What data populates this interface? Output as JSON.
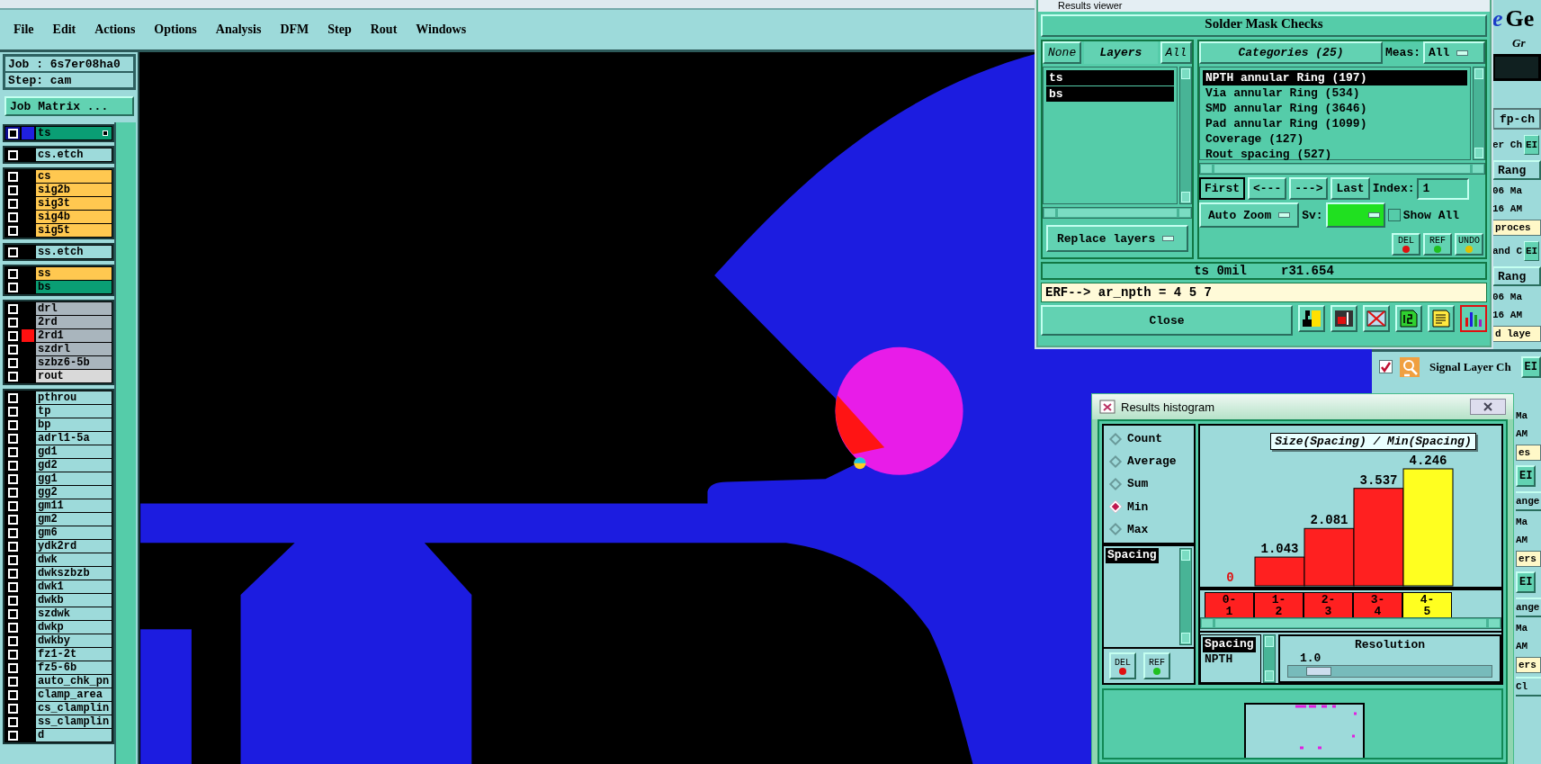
{
  "menu_bar": [
    "File",
    "Edit",
    "Actions",
    "Options",
    "Analysis",
    "DFM",
    "Step",
    "Rout",
    "Windows"
  ],
  "job_info": {
    "job": "Job : 6s7er08ha0",
    "step": "Step: cam",
    "matrix_button": "Job Matrix ..."
  },
  "layer_groups": [
    {
      "layers": [
        {
          "name": "ts",
          "kind": "mask",
          "color": "#2020e0",
          "active": true,
          "checked": false
        }
      ]
    },
    {
      "layers": [
        {
          "name": "cs.etch",
          "kind": "misc",
          "active": false,
          "checked": false
        }
      ]
    },
    {
      "layers": [
        {
          "name": "cs",
          "kind": "signal",
          "active": false,
          "checked": false
        },
        {
          "name": "sig2b",
          "kind": "signal",
          "active": false,
          "checked": false
        },
        {
          "name": "sig3t",
          "kind": "signal",
          "active": false,
          "checked": false
        },
        {
          "name": "sig4b",
          "kind": "signal",
          "active": false,
          "checked": false
        },
        {
          "name": "sig5t",
          "kind": "signal",
          "active": false,
          "checked": false
        }
      ]
    },
    {
      "layers": [
        {
          "name": "ss.etch",
          "kind": "misc",
          "active": false,
          "checked": false
        }
      ]
    },
    {
      "layers": [
        {
          "name": "ss",
          "kind": "signal",
          "active": false,
          "checked": false
        },
        {
          "name": "bs",
          "kind": "mask",
          "active": false,
          "checked": false
        }
      ]
    },
    {
      "layers": [
        {
          "name": "drl",
          "kind": "drill",
          "active": false,
          "checked": false
        },
        {
          "name": "2rd",
          "kind": "drill",
          "active": false,
          "checked": false
        },
        {
          "name": "2rd1",
          "kind": "drill",
          "color": "#ff1010",
          "active": false,
          "checked": false
        },
        {
          "name": "szdrl",
          "kind": "drill",
          "active": false,
          "checked": false
        },
        {
          "name": "szbz6-5b",
          "kind": "drill",
          "active": false,
          "checked": false
        },
        {
          "name": "rout",
          "kind": "rout",
          "active": false,
          "checked": false
        }
      ]
    },
    {
      "layers": [
        {
          "name": "pthrou",
          "kind": "misc",
          "active": false,
          "checked": false
        },
        {
          "name": "tp",
          "kind": "misc",
          "active": false,
          "checked": false
        },
        {
          "name": "bp",
          "kind": "misc",
          "active": false,
          "checked": false
        },
        {
          "name": "adrl1-5a",
          "kind": "misc",
          "active": false,
          "checked": false
        },
        {
          "name": "gd1",
          "kind": "misc",
          "active": false,
          "checked": false
        },
        {
          "name": "gd2",
          "kind": "misc",
          "active": false,
          "checked": false
        },
        {
          "name": "gg1",
          "kind": "misc",
          "active": false,
          "checked": false
        },
        {
          "name": "gg2",
          "kind": "misc",
          "active": false,
          "checked": false
        },
        {
          "name": "gm11",
          "kind": "misc",
          "active": false,
          "checked": false
        },
        {
          "name": "gm2",
          "kind": "misc",
          "active": false,
          "checked": false
        },
        {
          "name": "gm6",
          "kind": "misc",
          "active": false,
          "checked": false
        },
        {
          "name": "ydk2rd",
          "kind": "misc",
          "active": false,
          "checked": false
        },
        {
          "name": "dwk",
          "kind": "misc",
          "active": false,
          "checked": false
        },
        {
          "name": "dwkszbzb",
          "kind": "misc",
          "active": false,
          "checked": false
        },
        {
          "name": "dwk1",
          "kind": "misc",
          "active": false,
          "checked": false
        },
        {
          "name": "dwkb",
          "kind": "misc",
          "active": false,
          "checked": false
        },
        {
          "name": "szdwk",
          "kind": "misc",
          "active": false,
          "checked": false
        },
        {
          "name": "dwkp",
          "kind": "misc",
          "active": false,
          "checked": false
        },
        {
          "name": "dwkby",
          "kind": "misc",
          "active": false,
          "checked": false
        },
        {
          "name": "fz1-2t",
          "kind": "misc",
          "active": false,
          "checked": false
        },
        {
          "name": "fz5-6b",
          "kind": "misc",
          "active": false,
          "checked": false
        },
        {
          "name": "auto_chk_pn",
          "kind": "misc",
          "active": false,
          "checked": false
        },
        {
          "name": "clamp_area",
          "kind": "misc",
          "active": false,
          "checked": false
        },
        {
          "name": "cs_clamplin",
          "kind": "misc",
          "active": false,
          "checked": false
        },
        {
          "name": "ss_clamplin",
          "kind": "misc",
          "active": false,
          "checked": false
        },
        {
          "name": "d",
          "kind": "misc",
          "active": false,
          "checked": false
        }
      ]
    }
  ],
  "results_viewer": {
    "title": "Results viewer",
    "heading": "Solder Mask Checks",
    "layer_buttons": [
      "None",
      "Layers",
      "All"
    ],
    "layers": [
      {
        "name": "ts",
        "selected": true
      },
      {
        "name": "bs",
        "selected": true
      }
    ],
    "categories_button": "Categories (25)",
    "meas_label": "Meas:",
    "meas_value": "All",
    "categories": [
      {
        "label": "NPTH annular Ring (197)",
        "selected": true
      },
      {
        "label": "Via annular Ring (534)",
        "selected": false
      },
      {
        "label": "SMD annular Ring (3646)",
        "selected": false
      },
      {
        "label": "Pad annular Ring (1099)",
        "selected": false
      },
      {
        "label": "Coverage (127)",
        "selected": false
      },
      {
        "label": "Rout spacing (527)",
        "selected": false
      }
    ],
    "nav_buttons": [
      {
        "label": "First",
        "selected": true
      },
      {
        "label": "<---",
        "selected": false
      },
      {
        "label": "--->",
        "selected": false
      },
      {
        "label": "Last",
        "selected": false
      }
    ],
    "index_label": "Index:",
    "index_value": "1",
    "zoom_mode": "Auto Zoom",
    "sv_label": "Sv:",
    "show_all": {
      "label": "Show All",
      "checked": false
    },
    "replace_mode": "Replace layers",
    "action_buttons": [
      "DEL",
      "REF",
      "UNDO"
    ],
    "status": [
      "ts 0mil",
      "r31.654"
    ],
    "command": "ERF--> ar_npth = 4 5 7",
    "close": "Close",
    "tools": [
      {
        "kind": "figure",
        "selected": false
      },
      {
        "kind": "marker",
        "selected": false
      },
      {
        "kind": "crossed",
        "selected": false
      },
      {
        "kind": "page",
        "selected": false
      },
      {
        "kind": "notes",
        "selected": false
      },
      {
        "kind": "chart",
        "selected": true
      }
    ]
  },
  "histogram": {
    "title": "Results histogram",
    "modes": [
      {
        "label": "Count",
        "selected": false
      },
      {
        "label": "Average",
        "selected": false
      },
      {
        "label": "Sum",
        "selected": false
      },
      {
        "label": "Min",
        "selected": true
      },
      {
        "label": "Max",
        "selected": false
      }
    ],
    "measures": [
      {
        "label": "Spacing",
        "selected": true
      }
    ],
    "small_buttons": [
      "DEL",
      "REF"
    ],
    "chart_data": {
      "type": "bar",
      "title": "Size(Spacing) / Min(Spacing)",
      "categories": [
        "0-1",
        "1-2",
        "2-3",
        "3-4",
        "4-5"
      ],
      "values": [
        0,
        1.043,
        2.081,
        3.537,
        4.246
      ],
      "data_labels": true
    },
    "bins": [
      {
        "color": "#ff2020"
      },
      {
        "color": "#ff2020"
      },
      {
        "color": "#ff2020"
      },
      {
        "color": "#ff2020"
      },
      {
        "color": "#ffff20"
      }
    ],
    "filters": [
      {
        "label": "Spacing",
        "selected": true
      },
      {
        "label": "NPTH",
        "selected": false
      }
    ],
    "resolution_label": "Resolution",
    "resolution_value": "1.0",
    "resolution": {
      "level": 0.1
    }
  },
  "side_panel": {
    "logo_mark": "e",
    "logo_text": "Ge",
    "subtitle": "Gr",
    "rows": [
      {
        "kind": "title",
        "text": "fp-ch"
      },
      {
        "kind": "label_button",
        "text": "er Ch",
        "button": "EI"
      },
      {
        "kind": "header",
        "text": "Rang"
      },
      {
        "kind": "text",
        "text": "06 Ma"
      },
      {
        "kind": "text",
        "text": "16 AM"
      },
      {
        "kind": "field",
        "text": "proces"
      },
      {
        "kind": "label_button",
        "text": "and C",
        "button": "EI"
      },
      {
        "kind": "header",
        "text": "Rang"
      },
      {
        "kind": "text",
        "text": "06 Ma"
      },
      {
        "kind": "text",
        "text": "16 AM"
      },
      {
        "kind": "field",
        "text": "d laye"
      }
    ],
    "signal_row": {
      "checked": true,
      "label": "Signal Layer Ch",
      "button": "EI"
    },
    "lower_rows": [
      {
        "kind": "text",
        "text": "Ma"
      },
      {
        "kind": "text",
        "text": "AM"
      },
      {
        "kind": "field",
        "text": "es"
      },
      {
        "kind": "button",
        "text": "EI"
      },
      {
        "kind": "header",
        "text": "ange"
      },
      {
        "kind": "text",
        "text": "Ma"
      },
      {
        "kind": "text",
        "text": "AM"
      },
      {
        "kind": "field",
        "text": "ers"
      },
      {
        "kind": "button",
        "text": "EI"
      },
      {
        "kind": "header",
        "text": "ange"
      },
      {
        "kind": "text",
        "text": "Ma"
      },
      {
        "kind": "text",
        "text": "AM"
      },
      {
        "kind": "field",
        "text": "ers"
      },
      {
        "kind": "header",
        "text": "Cl"
      }
    ]
  }
}
